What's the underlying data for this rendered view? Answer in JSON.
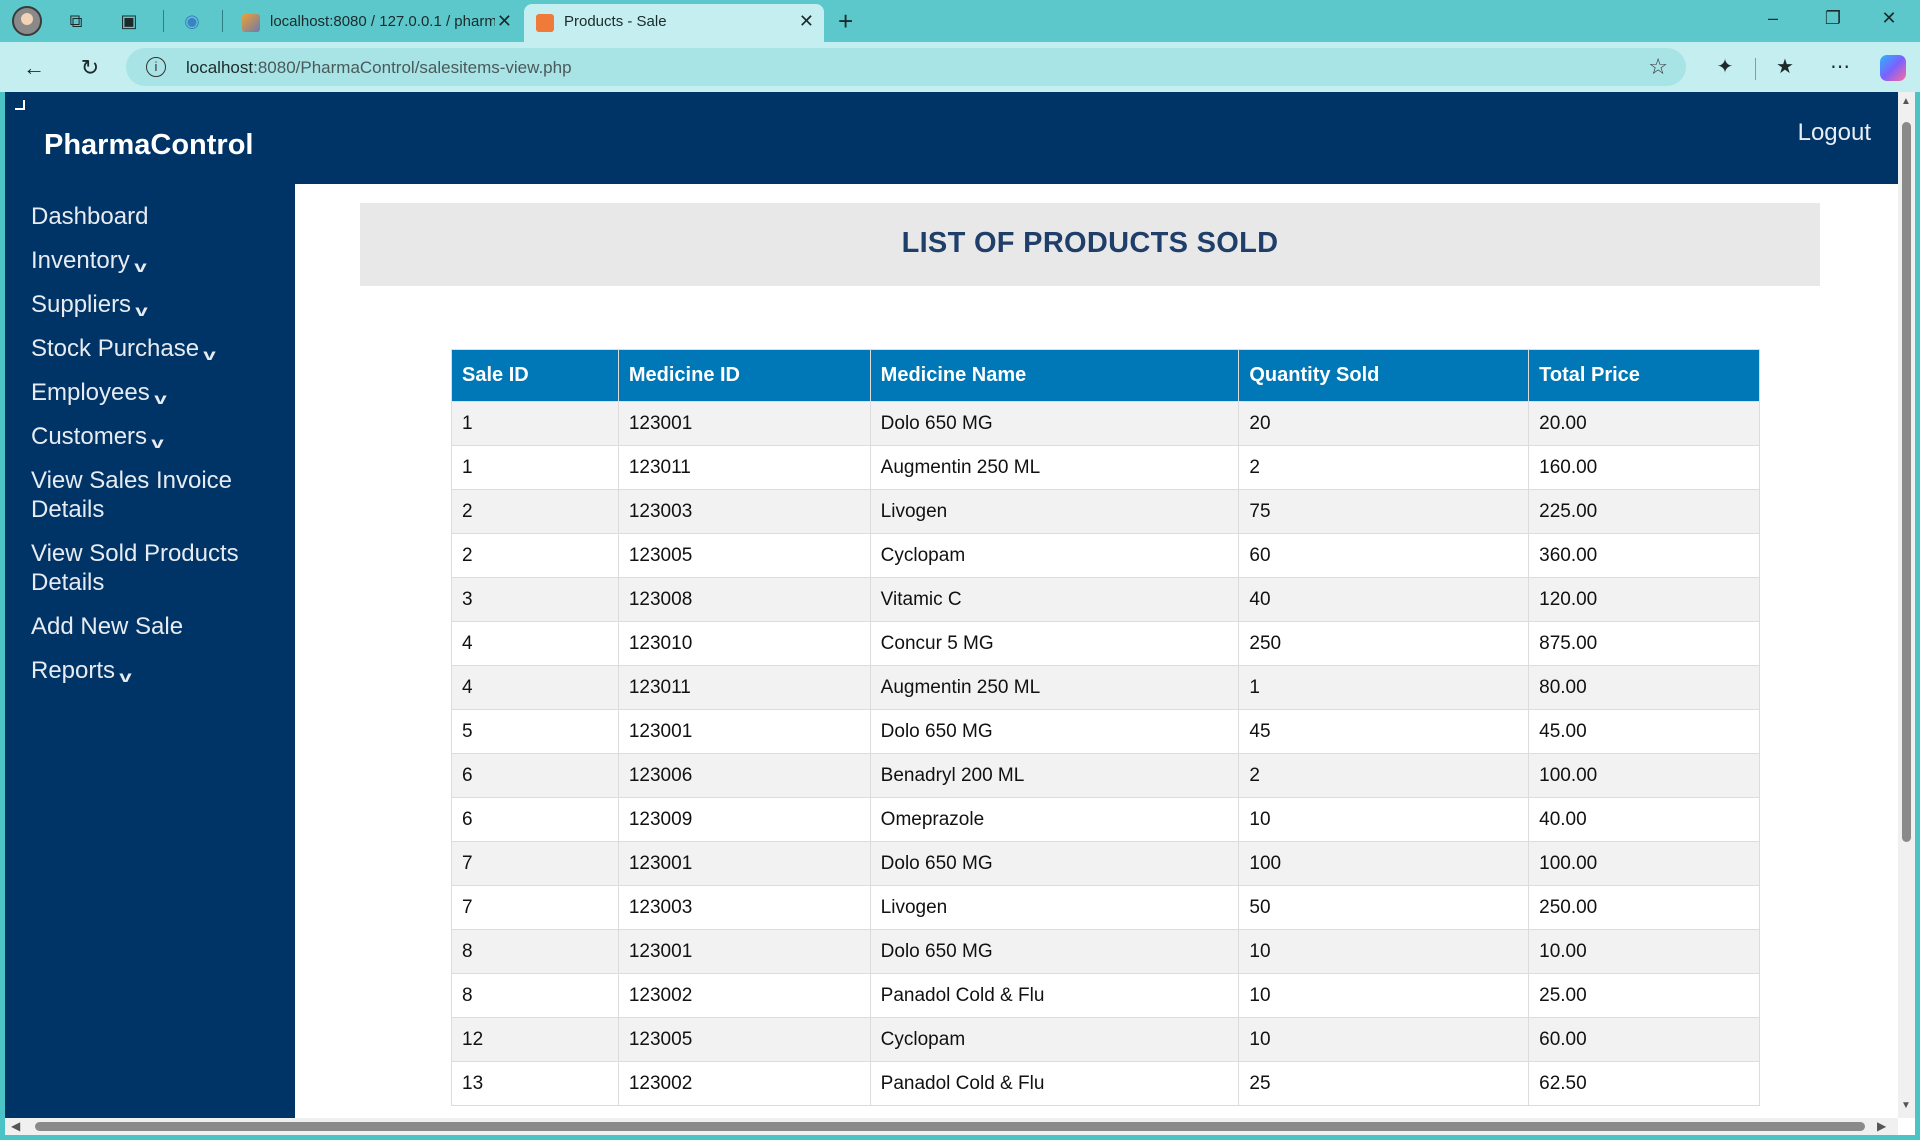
{
  "browser": {
    "tabs": [
      {
        "title": "localhost:8080 / 127.0.0.1 / pharm",
        "active": false
      },
      {
        "title": "Products - Sale",
        "active": true
      }
    ],
    "url_host": "localhost",
    "url_rest": ":8080/PharmaControl/salesitems-view.php",
    "icons": {
      "profile": "profile-avatar-icon",
      "workspaces": "workspaces-icon",
      "tab_actions": "tab-actions-icon",
      "back": "back-arrow-icon",
      "refresh": "refresh-icon",
      "favorite": "star-icon",
      "extensions": "extensions-icon",
      "favorites": "favorites-icon",
      "more": "more-icon",
      "copilot": "copilot-icon"
    }
  },
  "app": {
    "brand": "PharmaControl",
    "logout": "Logout",
    "colors": {
      "header": "#003366",
      "table_header": "#0077b6",
      "title": "#1f3f6a"
    },
    "sidebar": [
      {
        "label": "Dashboard",
        "dropdown": false
      },
      {
        "label": "Inventory",
        "dropdown": true
      },
      {
        "label": "Suppliers",
        "dropdown": true
      },
      {
        "label": "Stock Purchase",
        "dropdown": true
      },
      {
        "label": "Employees",
        "dropdown": true
      },
      {
        "label": "Customers",
        "dropdown": true
      },
      {
        "label": "View Sales Invoice Details",
        "dropdown": false
      },
      {
        "label": "View Sold Products Details",
        "dropdown": false
      },
      {
        "label": "Add New Sale",
        "dropdown": false
      },
      {
        "label": "Reports",
        "dropdown": true
      }
    ],
    "page_title": "LIST OF PRODUCTS SOLD",
    "table": {
      "columns": [
        "Sale ID",
        "Medicine ID",
        "Medicine Name",
        "Quantity Sold",
        "Total Price"
      ],
      "rows": [
        [
          "1",
          "123001",
          "Dolo 650 MG",
          "20",
          "20.00"
        ],
        [
          "1",
          "123011",
          "Augmentin 250 ML",
          "2",
          "160.00"
        ],
        [
          "2",
          "123003",
          "Livogen",
          "75",
          "225.00"
        ],
        [
          "2",
          "123005",
          "Cyclopam",
          "60",
          "360.00"
        ],
        [
          "3",
          "123008",
          "Vitamic C",
          "40",
          "120.00"
        ],
        [
          "4",
          "123010",
          "Concur 5 MG",
          "250",
          "875.00"
        ],
        [
          "4",
          "123011",
          "Augmentin 250 ML",
          "1",
          "80.00"
        ],
        [
          "5",
          "123001",
          "Dolo 650 MG",
          "45",
          "45.00"
        ],
        [
          "6",
          "123006",
          "Benadryl 200 ML",
          "2",
          "100.00"
        ],
        [
          "6",
          "123009",
          "Omeprazole",
          "10",
          "40.00"
        ],
        [
          "7",
          "123001",
          "Dolo 650 MG",
          "100",
          "100.00"
        ],
        [
          "7",
          "123003",
          "Livogen",
          "50",
          "250.00"
        ],
        [
          "8",
          "123001",
          "Dolo 650 MG",
          "10",
          "10.00"
        ],
        [
          "8",
          "123002",
          "Panadol Cold & Flu",
          "10",
          "25.00"
        ],
        [
          "12",
          "123005",
          "Cyclopam",
          "10",
          "60.00"
        ],
        [
          "13",
          "123002",
          "Panadol Cold & Flu",
          "25",
          "62.50"
        ]
      ]
    }
  }
}
